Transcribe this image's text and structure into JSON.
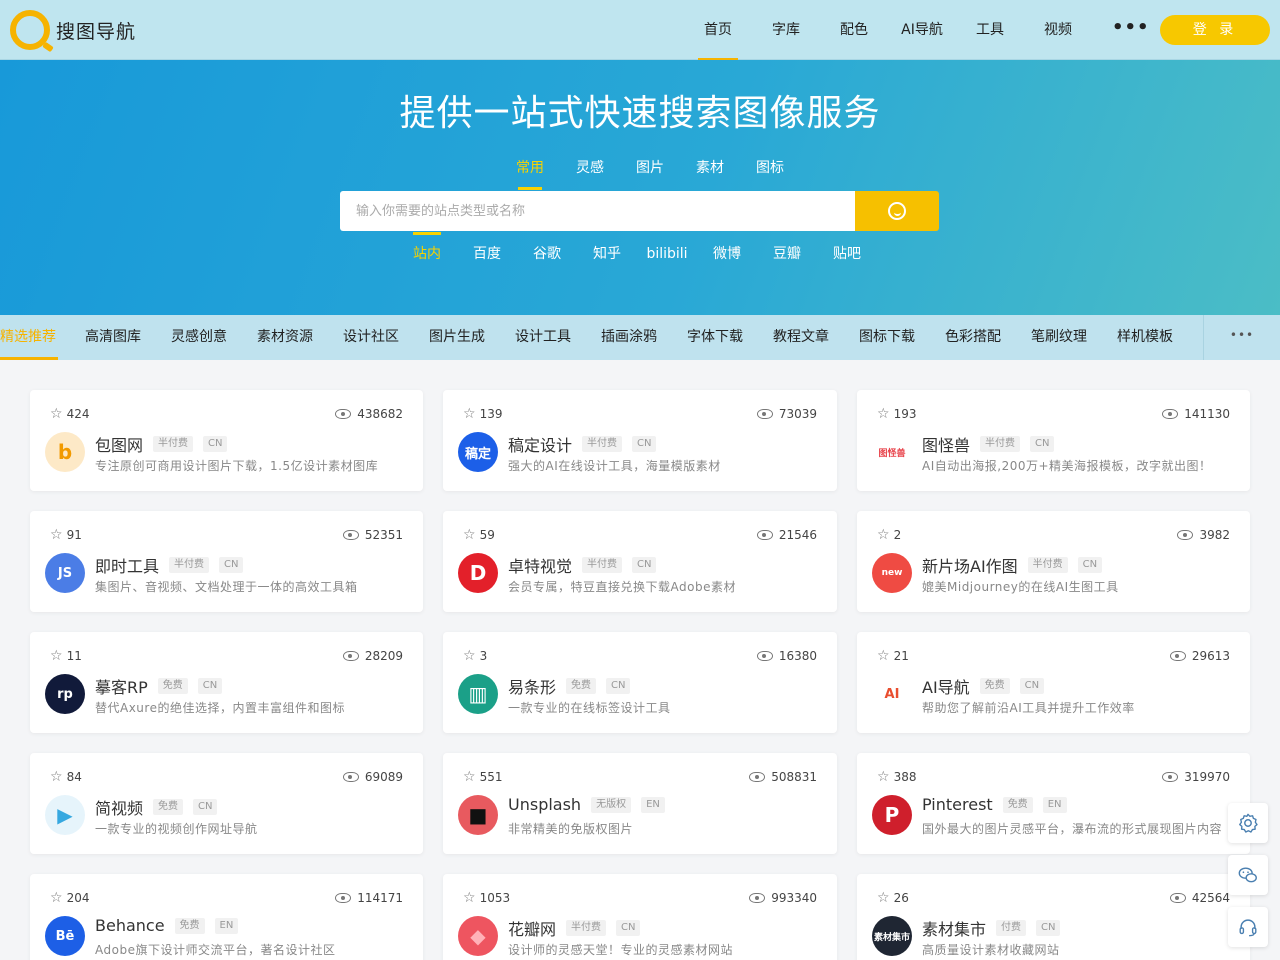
{
  "header": {
    "logo_text": "搜图导航",
    "nav": [
      "首页",
      "字库",
      "配色",
      "AI导航",
      "工具",
      "视频"
    ],
    "nav_more": "•••",
    "login_label": "登 录"
  },
  "hero": {
    "title": "提供一站式快速搜索图像服务",
    "search_tabs": [
      "常用",
      "灵感",
      "图片",
      "素材",
      "图标"
    ],
    "search_placeholder": "输入你需要的站点类型或名称",
    "engines": [
      "站内",
      "百度",
      "谷歌",
      "知乎",
      "bilibili",
      "微博",
      "豆瓣",
      "贴吧"
    ]
  },
  "categories": {
    "items": [
      "精选推荐",
      "高清图库",
      "灵感创意",
      "素材资源",
      "设计社区",
      "图片生成",
      "设计工具",
      "插画涂鸦",
      "字体下载",
      "教程文章",
      "图标下载",
      "色彩搭配",
      "笔刷纹理",
      "样机模板"
    ],
    "more": "•••"
  },
  "cards": [
    {
      "stars": "424",
      "views": "438682",
      "name": "包图网",
      "tag": "半付费",
      "lang": "CN",
      "desc": "专注原创可商用设计图片下载，1.5亿设计素材图库",
      "logo_text": "b",
      "logo_bg": "#fde9c7",
      "logo_fg": "#f29a00"
    },
    {
      "stars": "139",
      "views": "73039",
      "name": "稿定设计",
      "tag": "半付费",
      "lang": "CN",
      "desc": "强大的AI在线设计工具，海量模版素材",
      "logo_text": "稿定",
      "logo_bg": "#1c5fe8",
      "logo_fg": "#ffffff"
    },
    {
      "stars": "193",
      "views": "141130",
      "name": "图怪兽",
      "tag": "半付费",
      "lang": "CN",
      "desc": "AI自动出海报,200万+精美海报模板，改字就出图！",
      "logo_text": "图怪兽",
      "logo_bg": "#ffffff",
      "logo_fg": "#e8434b"
    },
    {
      "stars": "91",
      "views": "52351",
      "name": "即时工具",
      "tag": "半付费",
      "lang": "CN",
      "desc": "集图片、音视频、文档处理于一体的高效工具箱",
      "logo_text": "JS",
      "logo_bg": "#4b7de6",
      "logo_fg": "#ffffff"
    },
    {
      "stars": "59",
      "views": "21546",
      "name": "卓特视觉",
      "tag": "半付费",
      "lang": "CN",
      "desc": "会员专属，特豆直接兑换下载Adobe素材",
      "logo_text": "D",
      "logo_bg": "#e3202a",
      "logo_fg": "#ffffff"
    },
    {
      "stars": "2",
      "views": "3982",
      "name": "新片场AI作图",
      "tag": "半付费",
      "lang": "CN",
      "desc": "媲美Midjourney的在线AI生图工具",
      "logo_text": "new",
      "logo_bg": "#ef4b43",
      "logo_fg": "#ffffff"
    },
    {
      "stars": "11",
      "views": "28209",
      "name": "摹客RP",
      "tag": "免费",
      "lang": "CN",
      "desc": "替代Axure的绝佳选择，内置丰富组件和图标",
      "logo_text": "rp",
      "logo_bg": "#111a3a",
      "logo_fg": "#ffffff"
    },
    {
      "stars": "3",
      "views": "16380",
      "name": "易条形",
      "tag": "免费",
      "lang": "CN",
      "desc": "一款专业的在线标签设计工具",
      "logo_text": "▥",
      "logo_bg": "#1ba088",
      "logo_fg": "#ffffff"
    },
    {
      "stars": "21",
      "views": "29613",
      "name": "AI导航",
      "tag": "免费",
      "lang": "CN",
      "desc": "帮助您了解前沿AI工具并提升工作效率",
      "logo_text": "AI",
      "logo_bg": "#ffffff",
      "logo_fg": "#e94e2f"
    },
    {
      "stars": "84",
      "views": "69089",
      "name": "简视频",
      "tag": "免费",
      "lang": "CN",
      "desc": "一款专业的视频创作网址导航",
      "logo_text": "▶",
      "logo_bg": "#e6f4fb",
      "logo_fg": "#36a8e0"
    },
    {
      "stars": "551",
      "views": "508831",
      "name": "Unsplash",
      "tag": "无版权",
      "lang": "EN",
      "desc": "非常精美的免版权图片",
      "logo_text": "■",
      "logo_bg": "#e85a5f",
      "logo_fg": "#111111"
    },
    {
      "stars": "388",
      "views": "319970",
      "name": "Pinterest",
      "tag": "免费",
      "lang": "EN",
      "desc": "国外最大的图片灵感平台，瀑布流的形式展现图片内容",
      "logo_text": "P",
      "logo_bg": "#cf1f2c",
      "logo_fg": "#ffffff"
    },
    {
      "stars": "204",
      "views": "114171",
      "name": "Behance",
      "tag": "免费",
      "lang": "EN",
      "desc": "Adobe旗下设计师交流平台，著名设计社区",
      "logo_text": "Bē",
      "logo_bg": "#1d5fe6",
      "logo_fg": "#ffffff"
    },
    {
      "stars": "1053",
      "views": "993340",
      "name": "花瓣网",
      "tag": "半付费",
      "lang": "CN",
      "desc": "设计师的灵感天堂！专业的灵感素材网站",
      "logo_text": "◆",
      "logo_bg": "#ee5560",
      "logo_fg": "#ffb2b8"
    },
    {
      "stars": "26",
      "views": "42564",
      "name": "素材集市",
      "tag": "付费",
      "lang": "CN",
      "desc": "高质量设计素材收藏网站",
      "logo_text": "素材集市",
      "logo_bg": "#1f2633",
      "logo_fg": "#ffffff"
    }
  ],
  "side_tools": [
    "gear-icon",
    "wechat-icon",
    "headset-icon"
  ],
  "colors": {
    "accent": "#f6c000",
    "hero_start": "#1899d9",
    "hero_end": "#4bbdc6"
  }
}
